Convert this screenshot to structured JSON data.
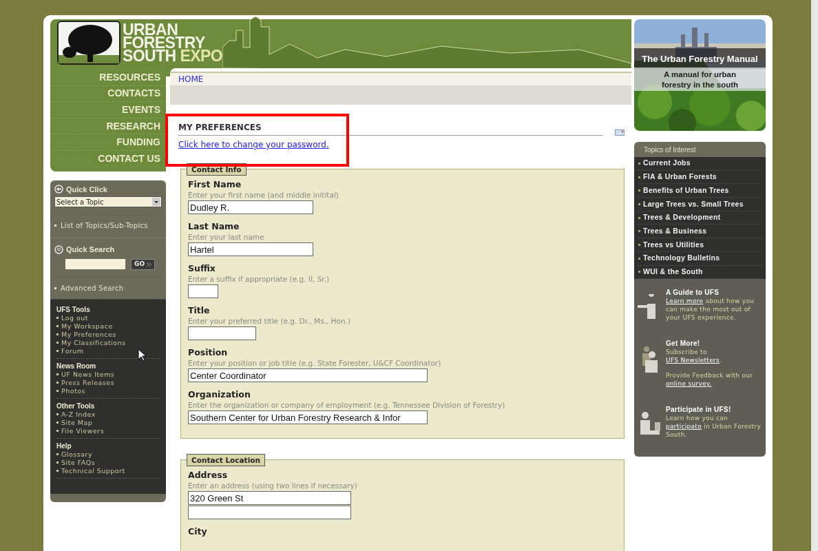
{
  "logo": {
    "lines": [
      "URBAN",
      "FORESTRY",
      "SOUTH"
    ],
    "accent": "EXPO"
  },
  "nav": [
    "RESOURCES",
    "CONTACTS",
    "EVENTS",
    "RESEARCH",
    "FUNDING",
    "CONTACT US"
  ],
  "quick_click": {
    "title": "Quick Click",
    "select": "Select a Topic",
    "link": "List of Topics/Sub-Topics"
  },
  "quick_search": {
    "title": "Quick Search",
    "button": "GO",
    "link": "Advanced Search"
  },
  "sidebar_sections": [
    {
      "title": "UFS Tools",
      "items": [
        "Log out",
        "My Workspace",
        "My Preferences",
        "My Classifications",
        "Forum"
      ]
    },
    {
      "title": "News Room",
      "items": [
        "UF News Items",
        "Press Releases",
        "Photos"
      ]
    },
    {
      "title": "Other Tools",
      "items": [
        "A-Z Index",
        "Site Map",
        "File Viewers"
      ]
    },
    {
      "title": "Help",
      "items": [
        "Glossary",
        "Site FAQs",
        "Technical Support"
      ]
    }
  ],
  "breadcrumb": "HOME",
  "page_title": "MY PREFERENCES",
  "password_link": "Click here to change your password.",
  "fieldsets": [
    {
      "legend": "Contact Info",
      "fields": [
        {
          "label": "First Name",
          "hint": "Enter your first name (and middle initital)",
          "inputs": [
            {
              "value": "Dudley R.",
              "kind": "medium"
            }
          ]
        },
        {
          "label": "Last Name",
          "hint": "Enter your last name",
          "inputs": [
            {
              "value": "Hartel",
              "kind": "medium"
            }
          ]
        },
        {
          "label": "Suffix",
          "hint": "Enter a suffix if appropriate (e.g. II, Sr.)",
          "inputs": [
            {
              "kind": "tiny"
            }
          ]
        },
        {
          "label": "Title",
          "hint": "Enter your preferred title (e.g. Dr., Ms., Hon.)",
          "inputs": [
            {
              "kind": "short"
            }
          ]
        },
        {
          "label": "Position",
          "hint": "Enter your position or job title (e.g. State Forester, U&CF Coordinator)",
          "inputs": [
            {
              "value": "Center Coordinator",
              "kind": "long"
            }
          ]
        },
        {
          "label": "Organization",
          "hint": "Enter the organization or company of employment (e.g. Tennessee Division of Forestry)",
          "inputs": [
            {
              "value": "Southern Center for Urban Forestry Research & Infor",
              "kind": "long"
            }
          ]
        }
      ]
    },
    {
      "legend": "Contact Location",
      "fields": [
        {
          "label": "Address",
          "hint": "Enter an address (using two lines if necessary)",
          "inputs": [
            {
              "value": "320 Green St",
              "kind": "wide"
            },
            {
              "kind": "wide"
            }
          ]
        },
        {
          "label": "City"
        }
      ]
    }
  ],
  "banner": {
    "title": "The Urban Forestry Manual",
    "subtitle": "A manual for urban forestry in the south"
  },
  "topics": {
    "title": "Topics of Interest",
    "items": [
      "Current Jobs",
      "FIA & Urban Forests",
      "Benefits of Urban Trees",
      "Large Trees vs. Small Trees",
      "Trees & Development",
      "Trees & Business",
      "Trees vs Utilities",
      "Technology Bulletins",
      "WUI & the South"
    ]
  },
  "promos": [
    {
      "kind": "pointing",
      "title": "A Guide to UFS",
      "paragraphs": [
        [
          {
            "text": "Learn more",
            "link": true
          },
          {
            "text": " about how you can make the most out of your UFS experience."
          }
        ]
      ]
    },
    {
      "kind": "pair",
      "title": "Get More!",
      "paragraphs": [
        [
          {
            "text": "Subscribe to "
          },
          {
            "text": "UFS Newsletters",
            "link": true
          },
          {
            "text": "."
          }
        ],
        [
          {
            "text": "Provide Feedback with our "
          },
          {
            "text": "online survey.",
            "link": true
          }
        ]
      ]
    },
    {
      "kind": "laptop",
      "title": "Participate in UFS!",
      "paragraphs": [
        [
          {
            "text": "Learn how you can "
          },
          {
            "text": "participate",
            "link": true
          },
          {
            "text": " in Urban Forestry South."
          }
        ]
      ]
    }
  ]
}
